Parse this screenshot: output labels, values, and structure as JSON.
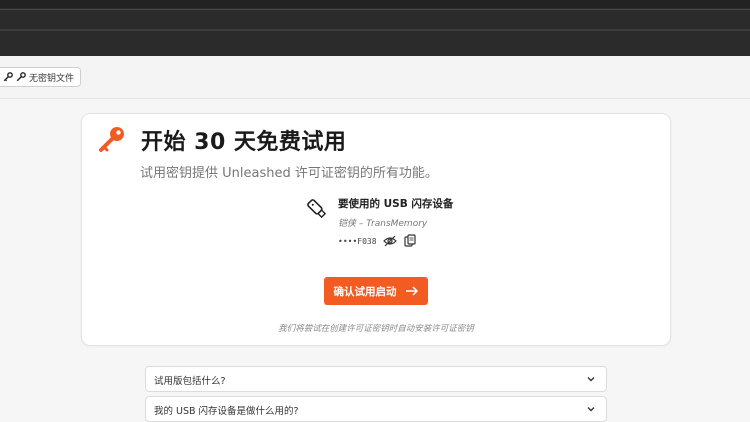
{
  "subbar": {
    "keyfile_label": "无密钥文件"
  },
  "card": {
    "title": "开始 30 天免费试用",
    "subtitle": "试用密钥提供 Unleashed 许可证密钥的所有功能。",
    "usb": {
      "title": "要使用的 USB 闪存设备",
      "device": "铠侠 – TransMemory",
      "masked_guid": "••••F038"
    },
    "confirm_label": "确认试用启动",
    "note": "我们将尝试在创建许可证密钥时自动安装许可证密钥"
  },
  "faq": [
    {
      "question": "试用版包括什么?"
    },
    {
      "question": "我的 USB 闪存设备是做什么用的?"
    }
  ],
  "colors": {
    "accent": "#f25c22",
    "topbar": "#2b2b2b"
  }
}
